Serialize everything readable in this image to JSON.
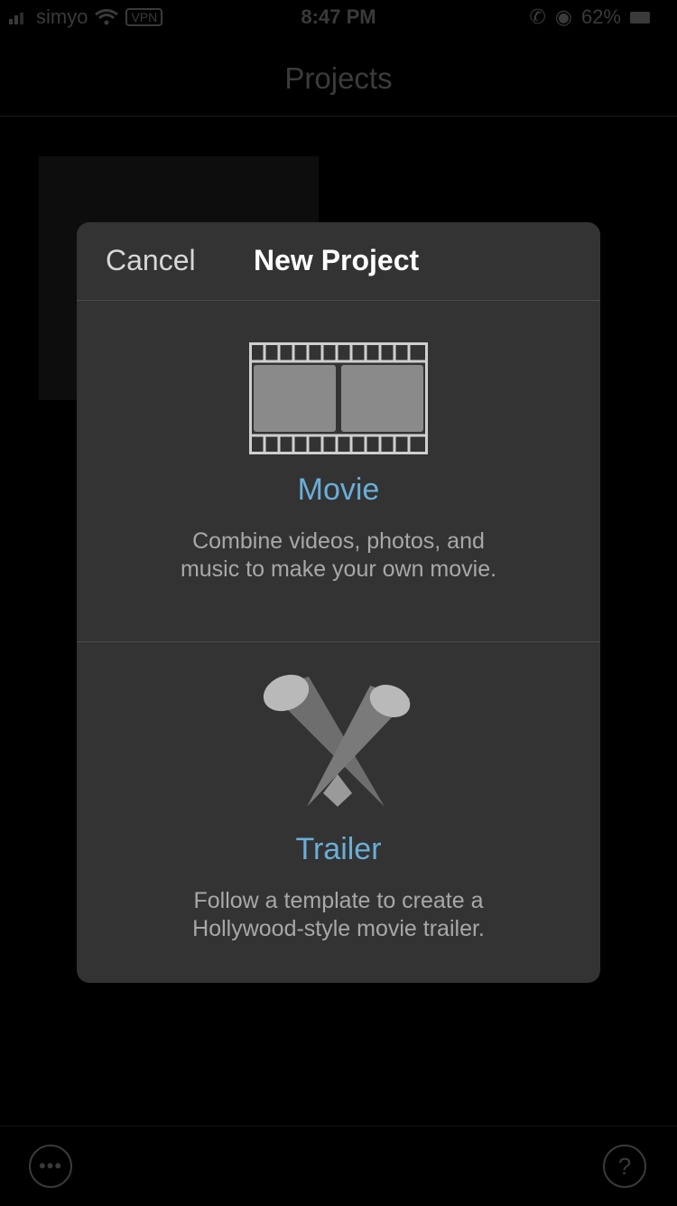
{
  "status_bar": {
    "carrier": "simyo",
    "network": "VPN",
    "time": "8:47 PM",
    "battery": "62%"
  },
  "nav": {
    "title": "Projects"
  },
  "sheet": {
    "cancel_label": "Cancel",
    "title": "New Project",
    "options": [
      {
        "icon": "film-strip-icon",
        "label": "Movie",
        "description_line1": "Combine videos, photos, and",
        "description_line2": "music to make your own movie."
      },
      {
        "icon": "spotlights-icon",
        "label": "Trailer",
        "description_line1": "Follow a template to create a",
        "description_line2": "Hollywood-style movie trailer."
      }
    ]
  },
  "bottom_bar": {
    "more_icon": "ellipsis-icon",
    "help_label": "?"
  },
  "colors": {
    "accent": "#6aaed8",
    "sheet_bg": "#333333",
    "background": "#000000"
  }
}
